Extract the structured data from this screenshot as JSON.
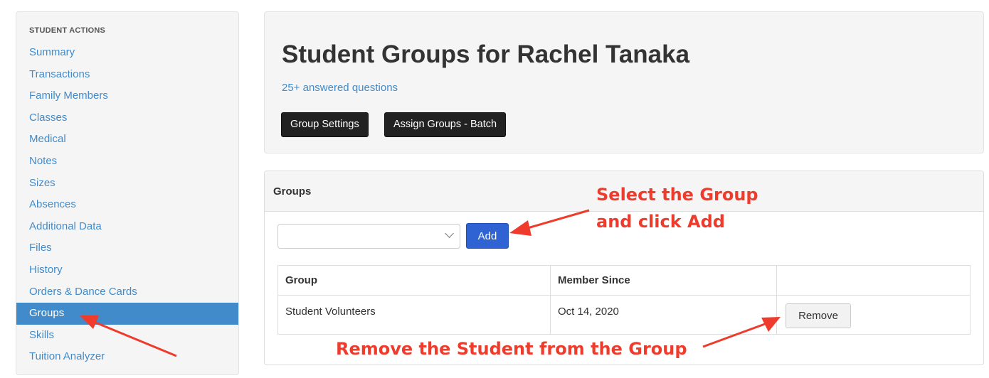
{
  "sidebar": {
    "heading": "STUDENT ACTIONS",
    "items": [
      {
        "label": "Summary"
      },
      {
        "label": "Transactions"
      },
      {
        "label": "Family Members"
      },
      {
        "label": "Classes"
      },
      {
        "label": "Medical"
      },
      {
        "label": "Notes"
      },
      {
        "label": "Sizes"
      },
      {
        "label": "Absences"
      },
      {
        "label": "Additional Data"
      },
      {
        "label": "Files"
      },
      {
        "label": "History"
      },
      {
        "label": "Orders & Dance Cards"
      },
      {
        "label": "Groups",
        "active": true
      },
      {
        "label": "Skills"
      },
      {
        "label": "Tuition Analyzer"
      }
    ]
  },
  "header": {
    "title": "Student Groups for Rachel Tanaka",
    "answered_link": "25+ answered questions",
    "group_settings_label": "Group Settings",
    "assign_batch_label": "Assign Groups - Batch"
  },
  "groups_panel": {
    "heading": "Groups",
    "select_value": "",
    "add_label": "Add",
    "table": {
      "columns": [
        "Group",
        "Member Since",
        ""
      ],
      "rows": [
        {
          "group": "Student Volunteers",
          "member_since": "Oct 14, 2020",
          "action_label": "Remove"
        }
      ]
    }
  },
  "annotations": {
    "select_note_line1": "Select the Group",
    "select_note_line2": "and click Add",
    "remove_note": "Remove the Student from the Group",
    "color": "#ef3b2c"
  },
  "colors": {
    "link": "#428bca",
    "active_bg": "#428bca",
    "primary_btn": "#2f63d3",
    "dark_btn": "#222222"
  }
}
